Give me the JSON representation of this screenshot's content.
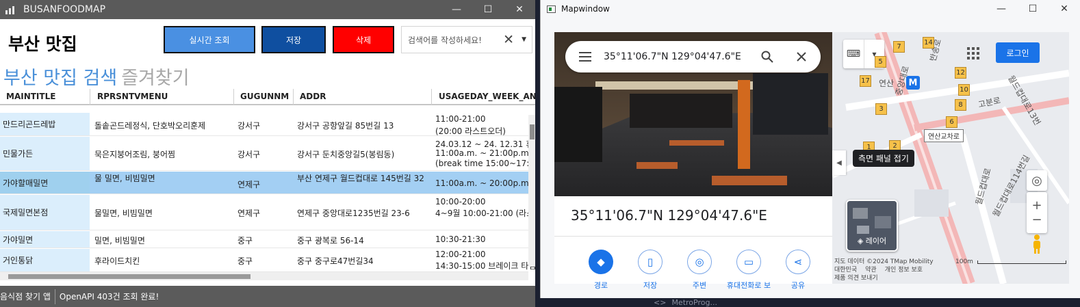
{
  "win1": {
    "title": "BUSANFOODMAP",
    "controls": {
      "min": "—",
      "max": "☐",
      "close": "✕"
    },
    "app_title": "부산 맛집",
    "buttons": {
      "live": "실시간 조회",
      "save": "저장",
      "delete": "삭제"
    },
    "search": {
      "placeholder": "검색어를 작성하세요!",
      "clear": "✕",
      "drop": "▼"
    },
    "tabs": [
      "부산 맛집 검색",
      "즐겨찾기"
    ],
    "columns": [
      "MAINTITLE",
      "RPRSNTVMENU",
      "GUGUNNM",
      "ADDR",
      "USAGEDAY_WEEK_AND"
    ],
    "rows": [
      {
        "title": "만드리곤드레밥",
        "menu": "돌솥곤드레정식, 단호박오리훈제",
        "gugun": "강서구",
        "addr": "강서구 공항앞길 85번길 13",
        "usage": [
          "11:00-21:00",
          "(20:00 라스트오더)"
        ]
      },
      {
        "title": "민물가든",
        "menu": "묵은지붕어조림, 붕어찜",
        "gugun": "강서구",
        "addr": "강서구 둔치중앙길5(봉림동)",
        "usage": [
          "24.03.12 ~ 24. 12.31 휴업",
          "11:00a.m. ~ 21:00p.m.",
          "(break time 15:00~17:00)"
        ]
      },
      {
        "title": "가야할매밀면",
        "menu": "물 밀면, 비빔밀면",
        "gugun": "연제구",
        "addr": "부산 연제구 월드컵대로 145번길 32",
        "usage": [
          "11:00a.m. ~ 20:00p.m."
        ]
      },
      {
        "title": "국제밀면본점",
        "menu": "물밀면, 비빔밀면",
        "gugun": "연제구",
        "addr": "연제구 중앙대로1235번길 23-6",
        "usage": [
          "10:00-20:00",
          "4~9월 10:00-21:00 (라스트"
        ]
      },
      {
        "title": "가야밀면",
        "menu": "밀면, 비빔밀면",
        "gugun": "중구",
        "addr": "중구 광복로 56-14",
        "usage": [
          "10:30-21:30"
        ]
      },
      {
        "title": "거인통닭",
        "menu": "후라이드치킨",
        "gugun": "중구",
        "addr": "중구 중구로47번길34",
        "usage": [
          "12:00-21:00",
          "14:30-15:00 브레이크 타임"
        ]
      }
    ],
    "status": {
      "app": "음식점 찾기 앱",
      "message": "OpenAPI 403건 조회 완료!"
    }
  },
  "win2": {
    "title": "Mapwindow",
    "controls": {
      "min": "—",
      "max": "☐",
      "close": "✕"
    },
    "search_value": "35°11'06.7\"N 129°04'47.6\"E",
    "place_title": "35°11'06.7\"N 129°04'47.6\"E",
    "actions": [
      "경로",
      "저장",
      "주변",
      "휴대전화로 보",
      "공유"
    ],
    "tooltip": "측면 패널 접기",
    "login": "로그인",
    "layer": "레이어",
    "map_labels": {
      "station": "연산",
      "road1": "중앙대로",
      "road2": "반송로",
      "road3": "고분로",
      "road4": "월드컵대로",
      "road5": "월드컵대로114번길",
      "road6": "월드컵대로13번",
      "intersection": "연산교차로"
    },
    "poi_numbers": [
      "7",
      "14",
      "5",
      "17",
      "12",
      "10",
      "3",
      "8",
      "6",
      "1",
      "2"
    ],
    "metro": "M",
    "attribution": {
      "line1": "지도 데이터 ©2024 TMap Mobility",
      "country": "대한민국",
      "terms": "약관",
      "privacy": "개인 정보 보호",
      "feedback": "제품 의견 보내기"
    },
    "scale": "100m"
  },
  "taskbar_fragment": "MetroProg..."
}
